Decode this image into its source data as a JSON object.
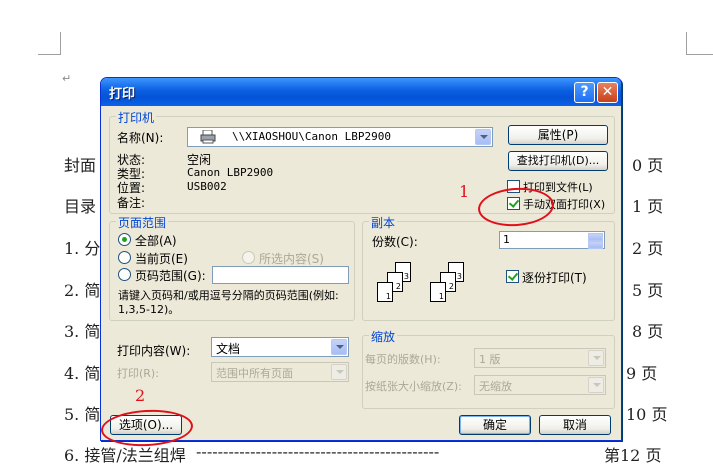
{
  "background": {
    "lines": [
      {
        "text": "封面",
        "right": "0 页"
      },
      {
        "text": "目录",
        "right": "1 页"
      },
      {
        "text": "1. 分",
        "right": "2 页"
      },
      {
        "text": "2. 简",
        "right": "5 页"
      },
      {
        "text": "3. 简",
        "right": "8 页"
      },
      {
        "text": "4. 简",
        "right": "9 页"
      },
      {
        "text": "5. 简",
        "right": "10 页"
      },
      {
        "text": "6. 接管/法兰组焊",
        "right": "第12 页"
      }
    ],
    "dashes": "---------------------------------------------",
    "para_mark": "↵"
  },
  "dialog": {
    "title": "打印",
    "help_label": "?",
    "close_label": "✕",
    "printer": {
      "group_label": "打印机",
      "name_label": "名称(N):",
      "name_value": "\\\\XIAOSHOU\\Canon LBP2900",
      "status_label": "状态:",
      "status_value": "空闲",
      "type_label": "类型:",
      "type_value": "Canon LBP2900",
      "location_label": "位置:",
      "location_value": "USB002",
      "comment_label": "备注:",
      "properties_button": "属性(P)",
      "find_printer_button": "查找打印机(D)...",
      "print_to_file_label": "打印到文件(L)",
      "print_to_file_checked": false,
      "manual_duplex_label": "手动双面打印(X)",
      "manual_duplex_checked": true
    },
    "page_range": {
      "group_label": "页面范围",
      "all_label": "全部(A)",
      "current_label": "当前页(E)",
      "selection_label": "所选内容(S)",
      "pages_label": "页码范围(G):",
      "pages_value": "",
      "hint": "请键入页码和/或用逗号分隔的页码范围(例如: 1,3,5-12)。",
      "selected": "all"
    },
    "copies": {
      "group_label": "副本",
      "count_label": "份数(C):",
      "count_value": "1",
      "collate_label": "逐份打印(T)",
      "collate_checked": true
    },
    "print_what": {
      "label": "打印内容(W):",
      "value": "文档",
      "print_label": "打印(R):",
      "print_value": "范围中所有页面"
    },
    "zoom": {
      "group_label": "缩放",
      "pages_per_sheet_label": "每页的版数(H):",
      "pages_per_sheet_value": "1 版",
      "scale_label": "按纸张大小缩放(Z):",
      "scale_value": "无缩放"
    },
    "options_button": "选项(O)...",
    "ok_button": "确定",
    "cancel_button": "取消"
  },
  "annotations": {
    "one": "1",
    "two": "2",
    "color": "#e0101a"
  }
}
